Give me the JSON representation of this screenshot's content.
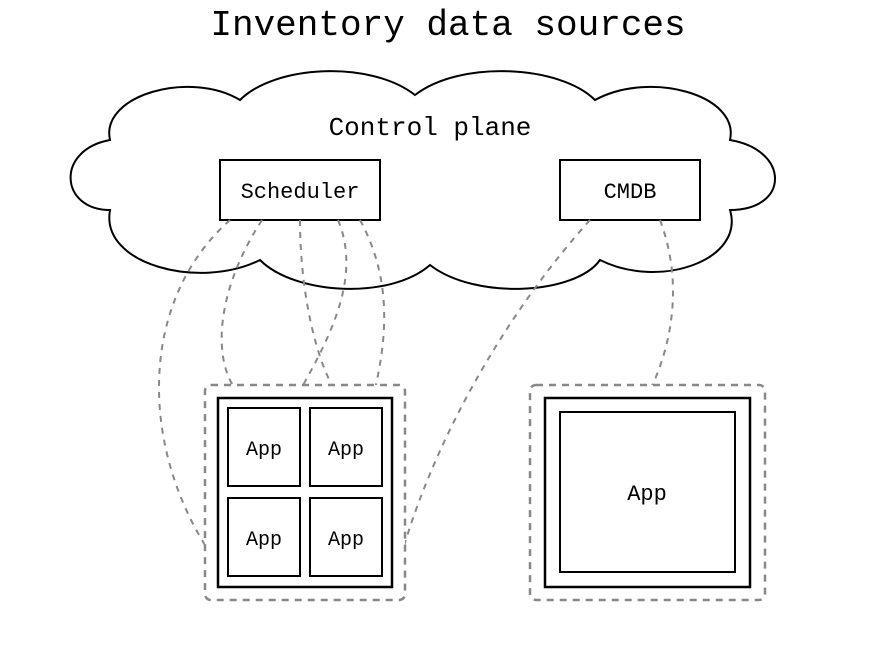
{
  "title": "Inventory data sources",
  "control_plane": {
    "label": "Control plane",
    "boxes": {
      "scheduler": "Scheduler",
      "cmdb": "CMDB"
    }
  },
  "hosts": {
    "left": {
      "apps": [
        "App",
        "App",
        "App",
        "App"
      ]
    },
    "right": {
      "apps": [
        "App"
      ]
    }
  },
  "connections": [
    {
      "from": "scheduler",
      "to": "left-host",
      "style": "dashed"
    },
    {
      "from": "scheduler",
      "to": "left-app-0",
      "style": "dashed"
    },
    {
      "from": "scheduler",
      "to": "left-app-1",
      "style": "dashed"
    },
    {
      "from": "scheduler",
      "to": "left-app-2",
      "style": "dashed"
    },
    {
      "from": "scheduler",
      "to": "left-app-3",
      "style": "dashed"
    },
    {
      "from": "cmdb",
      "to": "left-host",
      "style": "dashed"
    },
    {
      "from": "cmdb",
      "to": "right-host",
      "style": "dashed"
    }
  ]
}
